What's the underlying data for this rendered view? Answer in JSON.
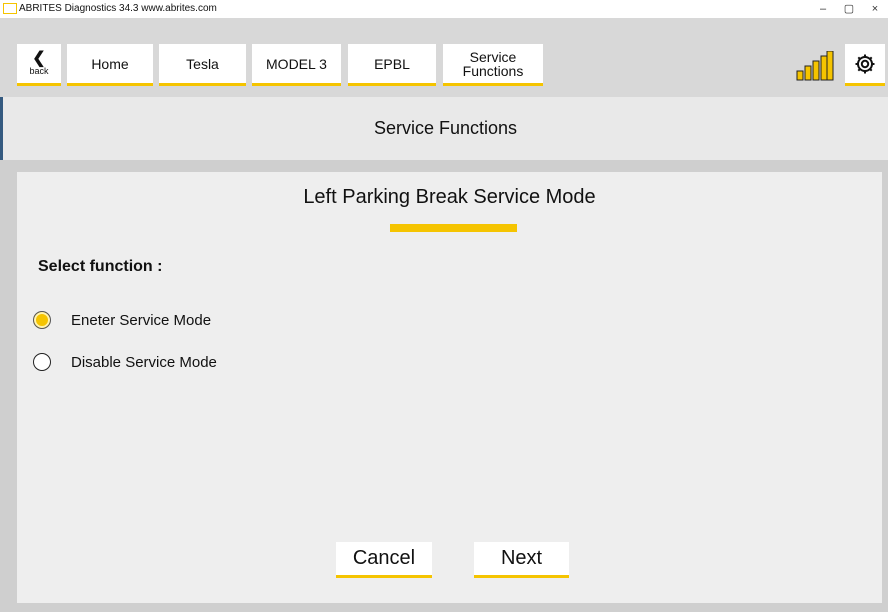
{
  "window": {
    "title": "ABRITES Diagnostics 34.3   www.abrites.com",
    "controls": [
      "–",
      "▢",
      "×"
    ]
  },
  "nav": {
    "back_label": "back",
    "back_icon": "chevron-left-icon",
    "breadcrumbs": [
      "Home",
      "Tesla",
      "MODEL 3",
      "EPBL"
    ],
    "service_line1": "Service",
    "service_line2": "Functions"
  },
  "status": {
    "signal_icon": "signal-bars-icon",
    "settings_icon": "gear-icon"
  },
  "header": {
    "title": "Service Functions"
  },
  "main": {
    "title": "Left Parking Break Service Mode",
    "select_label": "Select function :",
    "options": [
      {
        "label": "Eneter Service Mode",
        "selected": true
      },
      {
        "label": "Disable Service Mode",
        "selected": false
      }
    ]
  },
  "actions": {
    "cancel_label": "Cancel",
    "next_label": "Next"
  },
  "colors": {
    "accent": "#f5c400",
    "nav_bg": "#d8d8d8",
    "panel_bg": "#eeeeee"
  }
}
